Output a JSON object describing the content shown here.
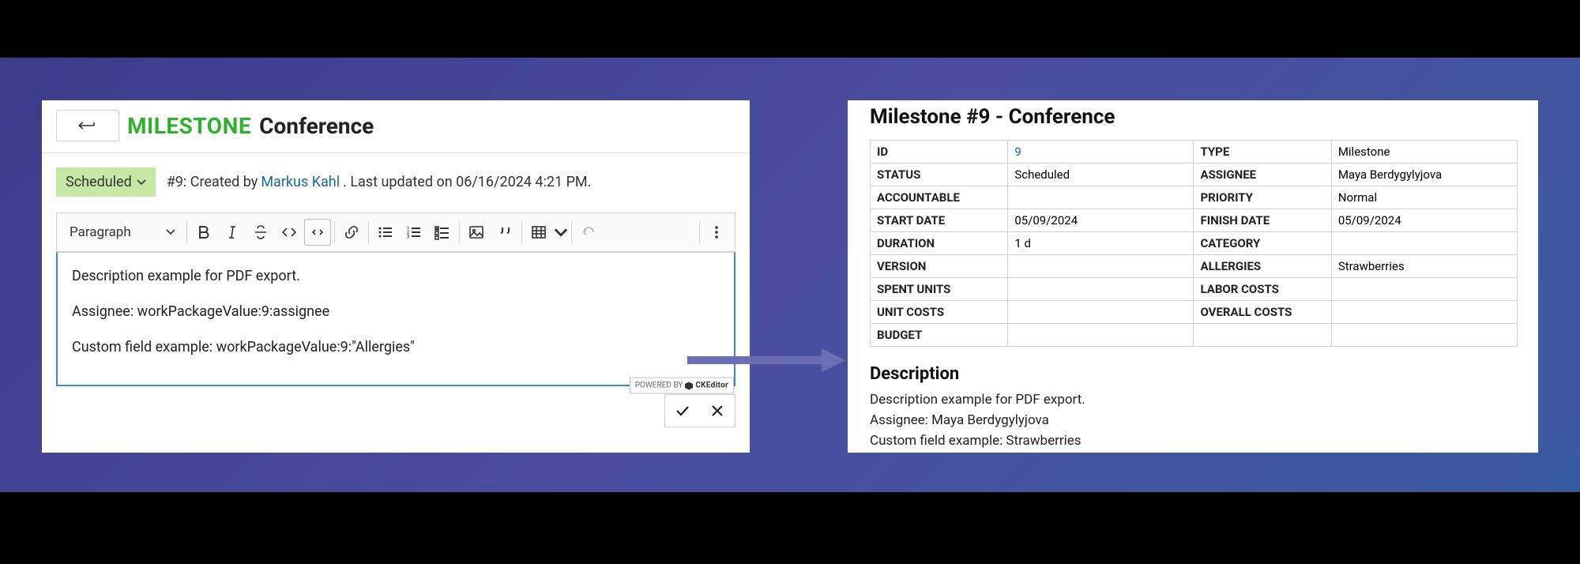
{
  "left": {
    "type_label": "MILESTONE",
    "title": "Conference",
    "status": "Scheduled",
    "meta_prefix": "#9: Created by ",
    "author": "Markus Kahl",
    "meta_suffix": ". Last updated on 06/16/2024 4:21 PM.",
    "toolbar": {
      "para_label": "Paragraph"
    },
    "editor_lines": [
      "Description example for PDF export.",
      "Assignee: workPackageValue:9:assignee",
      "Custom field example: workPackageValue:9:\"Allergies\""
    ],
    "powered_by": "POWERED BY",
    "powered_brand": "CKEditor"
  },
  "right": {
    "title": "Milestone #9 - Conference",
    "rows": [
      {
        "l1": "ID",
        "v1": "9",
        "v1_link": true,
        "l2": "TYPE",
        "v2": "Milestone"
      },
      {
        "l1": "STATUS",
        "v1": "Scheduled",
        "l2": "ASSIGNEE",
        "v2": "Maya Berdygylyjova"
      },
      {
        "l1": "ACCOUNTABLE",
        "v1": "",
        "l2": "PRIORITY",
        "v2": "Normal"
      },
      {
        "l1": "START DATE",
        "v1": "05/09/2024",
        "l2": "FINISH DATE",
        "v2": "05/09/2024"
      },
      {
        "l1": "DURATION",
        "v1": "1 d",
        "l2": "CATEGORY",
        "v2": ""
      },
      {
        "l1": "VERSION",
        "v1": "",
        "l2": "ALLERGIES",
        "v2": "Strawberries"
      },
      {
        "l1": "SPENT UNITS",
        "v1": "",
        "l2": "LABOR COSTS",
        "v2": ""
      },
      {
        "l1": "UNIT COSTS",
        "v1": "",
        "l2": "OVERALL COSTS",
        "v2": ""
      },
      {
        "l1": "BUDGET",
        "v1": "",
        "l2": "",
        "v2": ""
      }
    ],
    "desc_head": "Description",
    "desc_lines": [
      "Description example for PDF export.",
      "Assignee: Maya Berdygylyjova",
      "Custom field example: Strawberries"
    ]
  }
}
